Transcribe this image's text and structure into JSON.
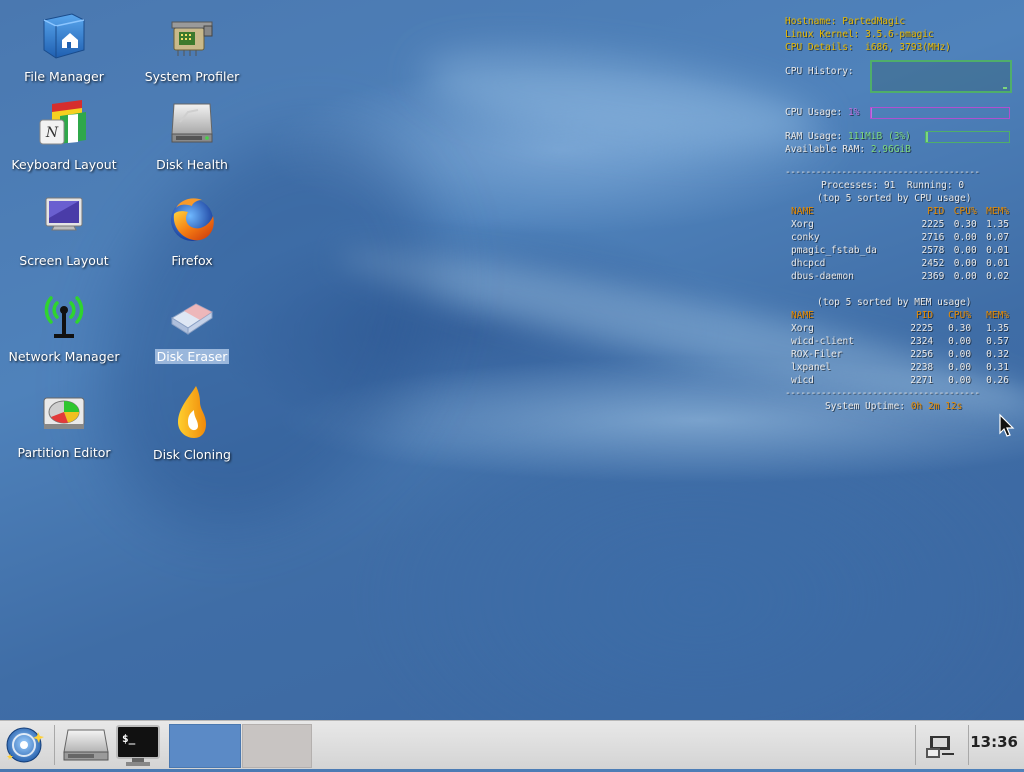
{
  "desktop": {
    "icons": [
      {
        "label": "File Manager",
        "icon": "file-manager-icon"
      },
      {
        "label": "System Profiler",
        "icon": "system-profiler-icon"
      },
      {
        "label": "Keyboard Layout",
        "icon": "keyboard-layout-icon"
      },
      {
        "label": "Disk Health",
        "icon": "disk-health-icon"
      },
      {
        "label": "Screen Layout",
        "icon": "screen-layout-icon"
      },
      {
        "label": "Firefox",
        "icon": "firefox-icon"
      },
      {
        "label": "Network Manager",
        "icon": "network-manager-icon"
      },
      {
        "label": "Disk Eraser",
        "icon": "disk-eraser-icon",
        "selected": true
      },
      {
        "label": "Partition Editor",
        "icon": "partition-editor-icon"
      },
      {
        "label": "Disk Cloning",
        "icon": "disk-cloning-icon"
      }
    ]
  },
  "conky": {
    "hostname_label": "Hostname:",
    "hostname": "PartedMagic",
    "kernel_label": "Linux Kernel:",
    "kernel": "3.5.6-pmagic",
    "cpu_details_label": "CPU Details:",
    "cpu_details": "i686, 3793(MHz)",
    "cpu_history_label": "CPU History:",
    "cpu_usage_label": "CPU Usage:",
    "cpu_usage": "1%",
    "cpu_usage_fraction": 0.01,
    "ram_usage_label": "RAM Usage:",
    "ram_usage": "111MiB (3%)",
    "ram_usage_fraction": 0.03,
    "available_ram_label": "Available RAM:",
    "available_ram": "2.96GiB",
    "separator": "--------------------------------------",
    "processes_label": "Processes:",
    "processes": "91",
    "running_label": "Running:",
    "running": "0",
    "cpu_table_title": "(top 5 sorted by CPU usage)",
    "mem_table_title": "(top 5 sorted by MEM usage)",
    "columns": [
      "NAME",
      "PID",
      "CPU%",
      "MEM%"
    ],
    "cpu_rows": [
      [
        "Xorg",
        "2225",
        "0.30",
        "1.35"
      ],
      [
        "conky",
        "2716",
        "0.00",
        "0.07"
      ],
      [
        "pmagic_fstab_da",
        "2578",
        "0.00",
        "0.01"
      ],
      [
        "dhcpcd",
        "2452",
        "0.00",
        "0.01"
      ],
      [
        "dbus-daemon",
        "2369",
        "0.00",
        "0.02"
      ]
    ],
    "mem_rows": [
      [
        "Xorg",
        "2225",
        "0.30",
        "1.35"
      ],
      [
        "wicd-client",
        "2324",
        "0.00",
        "0.57"
      ],
      [
        "ROX-Filer",
        "2256",
        "0.00",
        "0.32"
      ],
      [
        "lxpanel",
        "2238",
        "0.00",
        "0.31"
      ],
      [
        "wicd",
        "2271",
        "0.00",
        "0.26"
      ]
    ],
    "uptime_label": "System Uptime:",
    "uptime": "0h 2m 12s"
  },
  "taskbar": {
    "clock": "13:36",
    "buttons": [
      "start-menu-icon",
      "drive-icon",
      "terminal-icon"
    ]
  },
  "colors": {
    "accent_yellow": "#e6b800",
    "accent_orange": "#e68a00",
    "accent_green": "#7cd67c",
    "accent_purple": "#c070e0",
    "history_box": "#4fae6a"
  }
}
